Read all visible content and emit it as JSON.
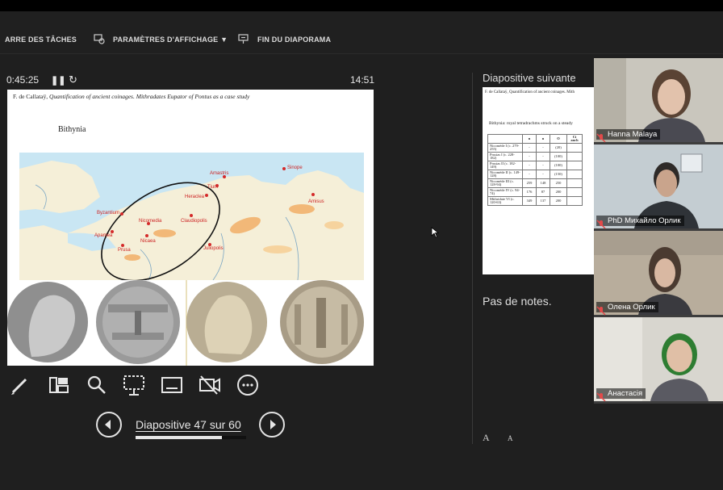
{
  "toolbar": {
    "taskbar_label": "ARRE DES TÂCHES",
    "display_settings_label": "PARAMÈTRES D'AFFICHAGE ▼",
    "end_show_label": "FIN DU DIAPORAMA"
  },
  "presenter": {
    "elapsed_time": "0:45:25",
    "clock": "14:51",
    "pause_glyph": "❚❚",
    "reset_glyph": "↻"
  },
  "current_slide": {
    "header_author": "F. de Callataÿ,",
    "header_title": "Quantification of ancient coinages. Mithradates Eupator of Pontus as a case study",
    "region_title": "Bithynia",
    "map_labels": [
      "Sinope",
      "Amastris",
      "Tium",
      "Heraclea",
      "Amisus",
      "Byzantium",
      "Nicomedia",
      "Claudiopolis",
      "Apamea",
      "Nicaea",
      "Juliopolis",
      "Prusa"
    ]
  },
  "controls": {
    "icons": [
      "pen-icon",
      "slides-grid-icon",
      "zoom-icon",
      "pointer-screen-icon",
      "subtitles-icon",
      "camera-off-icon",
      "more-options-icon"
    ]
  },
  "navigation": {
    "slide_label": "Diapositive 47 sur 60",
    "progress_fraction": 0.78
  },
  "next_slide": {
    "label": "Diapositive suivante",
    "header": "F. de Callataÿ, Quantification of ancient coinages. Mith",
    "caption": "Bithynia: royal tetradrachms struck on a steady",
    "table_headers": [
      "",
      "n",
      "n",
      "O",
      "Ci anch"
    ],
    "table_rows": [
      [
        "Nicomède I (c. 279-255)",
        "-",
        "-",
        "(20)",
        ""
      ],
      [
        "Prusias I (c. 228-182)",
        "-",
        "-",
        "(100)",
        ""
      ],
      [
        "Prusias II (c. 182-149)",
        "-",
        "-",
        "(100)",
        ""
      ],
      [
        "Nicomède II (c. 149-128)",
        "-",
        "-",
        "(150)",
        ""
      ],
      [
        "Nicomède III (c. 128-94)",
        "259",
        "148",
        "250",
        ""
      ],
      [
        "Nicomède IV (c. 94-74)",
        "176",
        "87",
        "200",
        ""
      ],
      [
        "Mithridate VI (c. 120-63)",
        "349",
        "137",
        "200",
        ""
      ]
    ]
  },
  "notes": {
    "text": "Pas de notes.",
    "font_increase": "A",
    "font_decrease": "A"
  },
  "participants": [
    {
      "name": "Hanna Malaya"
    },
    {
      "name": "PhD Михайло Орлик"
    },
    {
      "name": "Олена Орлик"
    },
    {
      "name": "Анастасія"
    }
  ],
  "colors": {
    "background": "#1f1f1f",
    "toolbar": "#202020",
    "map_sea": "#c9e6f3",
    "map_land": "#f5efd8",
    "map_highland": "#f2b878",
    "city_dot": "#d42a2a"
  }
}
